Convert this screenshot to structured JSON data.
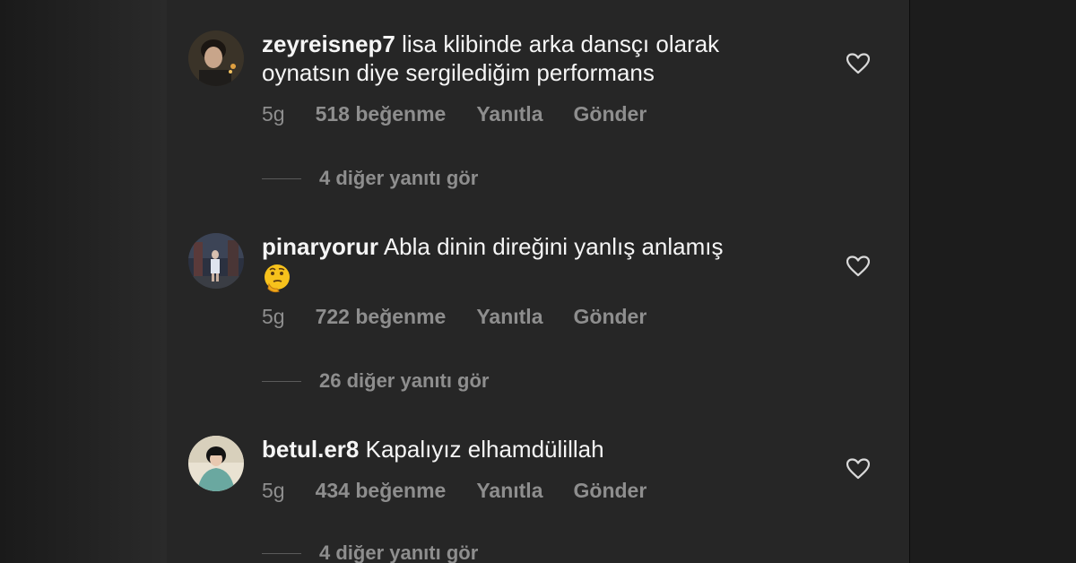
{
  "comments": [
    {
      "username": "zeyreisnep7",
      "text": "lisa klibinde arka dansçı olarak oynatsın diye sergilediğim performans",
      "time": "5g",
      "likes": "518 beğenme",
      "reply_label": "Yanıtla",
      "send_label": "Gönder",
      "view_replies": "4 diğer yanıtı gör"
    },
    {
      "username": "pinaryorur",
      "text": "Abla dinin direğini yanlış anlamış",
      "emoji": "thinking-face-emoji",
      "time": "5g",
      "likes": "722 beğenme",
      "reply_label": "Yanıtla",
      "send_label": "Gönder",
      "view_replies": "26 diğer yanıtı gör"
    },
    {
      "username": "betul.er8",
      "text": "Kapalıyız elhamdülillah",
      "time": "5g",
      "likes": "434 beğenme",
      "reply_label": "Yanıtla",
      "send_label": "Gönder",
      "view_replies": "4 diğer yanıtı gör"
    }
  ],
  "colors": {
    "panel_bg": "#262626",
    "text_primary": "#f5f5f5",
    "text_secondary": "#8e8e8e"
  },
  "icons": {
    "like": "heart-outline-icon"
  }
}
